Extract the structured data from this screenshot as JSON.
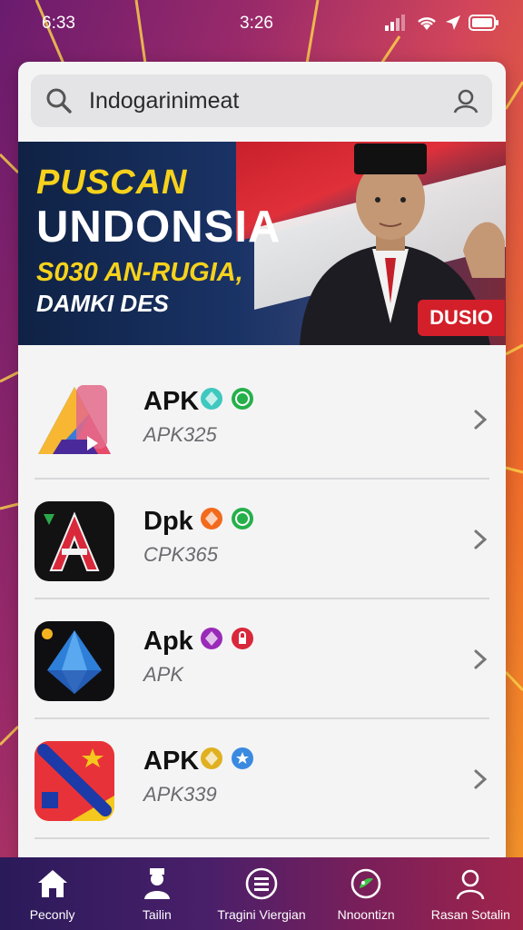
{
  "status": {
    "time_left": "6:33",
    "time_center": "3:26"
  },
  "search": {
    "value": "Indogarinimeat"
  },
  "banner": {
    "line1": "PUSCAN",
    "line2": "UNDONSIA",
    "line3": "S030 AN-RUGIA,",
    "line4": "DAMKI DES",
    "badge": "DUSIO"
  },
  "apps": [
    {
      "name": "APK",
      "sub": "APK325",
      "icon": "android-play-icon",
      "badges": [
        "gem-icon",
        "whatsapp-icon"
      ]
    },
    {
      "name": "Dpk",
      "sub": "CPK365",
      "icon": "letter-a-icon",
      "badges": [
        "gem-icon",
        "whatsapp-icon"
      ]
    },
    {
      "name": "Apk",
      "sub": "APK",
      "icon": "crystal-icon",
      "badges": [
        "gem-icon",
        "lock-icon"
      ]
    },
    {
      "name": "APK",
      "sub": "APK339",
      "icon": "flag-star-icon",
      "badges": [
        "gem-icon",
        "star-icon"
      ]
    }
  ],
  "nav": [
    {
      "label": "Peconly",
      "icon": "home-icon"
    },
    {
      "label": "Tailin",
      "icon": "user-hat-icon"
    },
    {
      "label": "Tragini Viergian",
      "icon": "grid-icon"
    },
    {
      "label": "Nnoontizn",
      "icon": "leaf-icon"
    },
    {
      "label": "Rasan Sotalin",
      "icon": "profile-icon"
    }
  ],
  "colors": {
    "accent_red": "#d31f2a",
    "banner_yellow": "#f6d21c",
    "whatsapp_green": "#25b04a"
  }
}
